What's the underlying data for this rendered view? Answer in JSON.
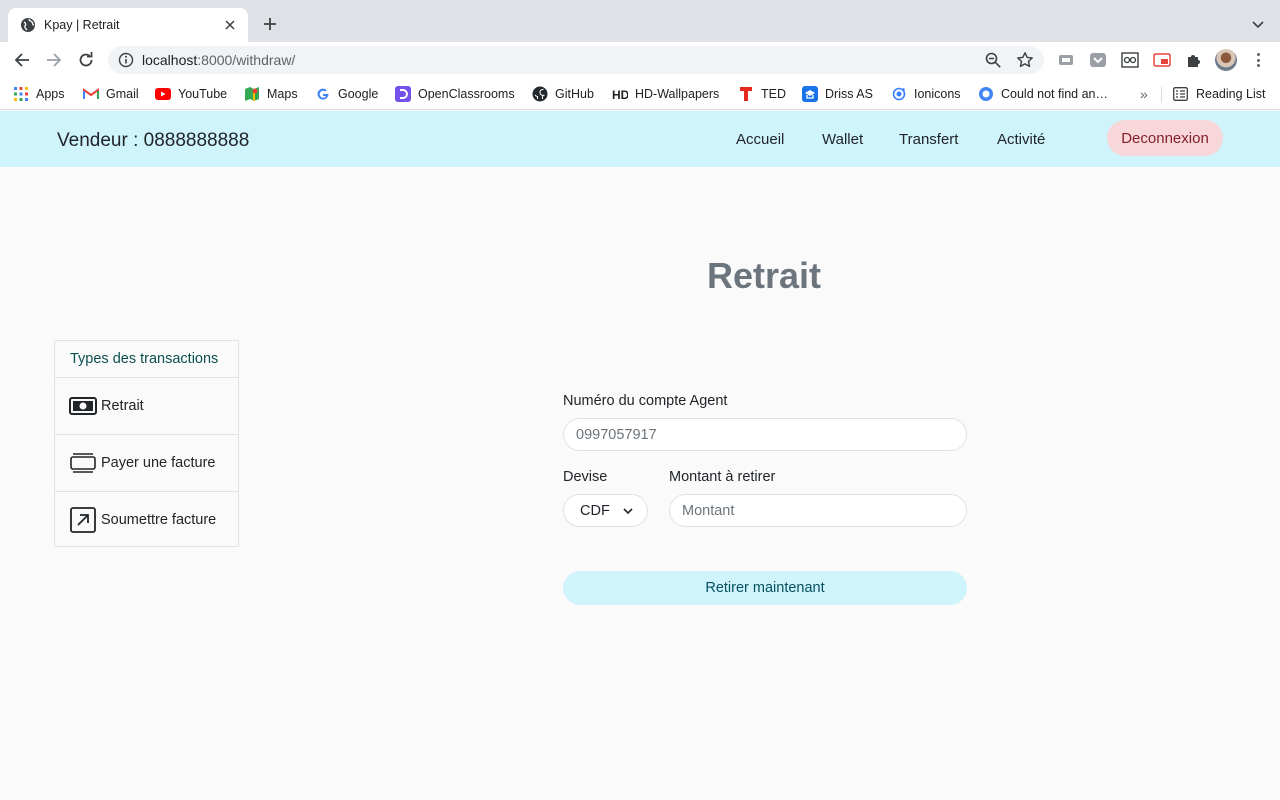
{
  "browser": {
    "tab_title": "Kpay | Retrait",
    "url_host": "localhost",
    "url_rest": ":8000/withdraw/",
    "bookmarks": [
      {
        "label": "Apps",
        "icon": "apps-grid-icon"
      },
      {
        "label": "Gmail",
        "icon": "gmail-icon"
      },
      {
        "label": "YouTube",
        "icon": "youtube-icon"
      },
      {
        "label": "Maps",
        "icon": "maps-icon"
      },
      {
        "label": "Google",
        "icon": "google-icon"
      },
      {
        "label": "OpenClassrooms",
        "icon": "openclassrooms-icon"
      },
      {
        "label": "GitHub",
        "icon": "github-icon"
      },
      {
        "label": "HD-Wallpapers",
        "icon": "hd-wallpapers-icon"
      },
      {
        "label": "TED",
        "icon": "ted-icon"
      },
      {
        "label": "Driss AS",
        "icon": "driss-icon"
      },
      {
        "label": "Ionicons",
        "icon": "ionicons-icon"
      },
      {
        "label": "Could not find an…",
        "icon": "globe-icon"
      }
    ],
    "more_bookmarks": "»",
    "reading_list": "Reading List"
  },
  "navbar": {
    "brand": "Vendeur : 0888888888",
    "links": [
      "Accueil",
      "Wallet",
      "Transfert",
      "Activité"
    ],
    "logout": "Deconnexion"
  },
  "page": {
    "title": "Retrait"
  },
  "sidebar": {
    "header": "Types des transactions",
    "items": [
      {
        "label": "Retrait",
        "icon": "cash-icon"
      },
      {
        "label": "Payer une facture",
        "icon": "card-icon"
      },
      {
        "label": "Soumettre facture",
        "icon": "arrow-up-right-square-icon"
      }
    ]
  },
  "form": {
    "account_label": "Numéro du compte Agent",
    "account_placeholder": "0997057917",
    "currency_label": "Devise",
    "currency_value": "CDF",
    "amount_label": "Montant à retirer",
    "amount_placeholder": "Montant",
    "submit_label": "Retirer maintenant"
  },
  "colors": {
    "navbar_bg": "#cff4fc",
    "logout_bg": "#f8d7da",
    "title_color": "#6c757d",
    "submit_bg": "#cff4fc"
  }
}
